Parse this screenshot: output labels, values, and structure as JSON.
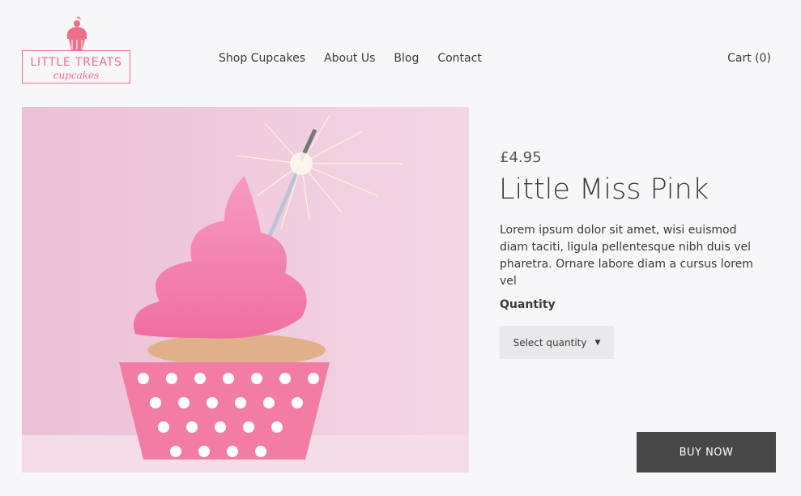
{
  "brand": {
    "name": "LITTLE TREATS",
    "tagline": "cupcakes",
    "color": "#ee6f88"
  },
  "nav": {
    "items": [
      {
        "label": "Shop Cupcakes"
      },
      {
        "label": "About Us"
      },
      {
        "label": "Blog"
      },
      {
        "label": "Contact"
      }
    ],
    "cart_label": "Cart (0)"
  },
  "product": {
    "image_icon": "cupcake-with-sparkler-photo",
    "price": "£4.95",
    "name": "Little Miss Pink",
    "description": "Lorem ipsum dolor sit amet, wisi euismod diam taciti, ligula pellentesque nibh duis vel pharetra. Ornare labore diam a cursus lorem vel",
    "quantity_label": "Quantity",
    "quantity_select": "Select quantity",
    "quantity_caret_icon": "caret-down-icon",
    "buy_label": "BUY NOW"
  },
  "colors": {
    "background": "#f7f7f9",
    "accent_pink": "#ee6f88",
    "button_dark": "#474747",
    "select_bg": "#e9e9eb"
  }
}
